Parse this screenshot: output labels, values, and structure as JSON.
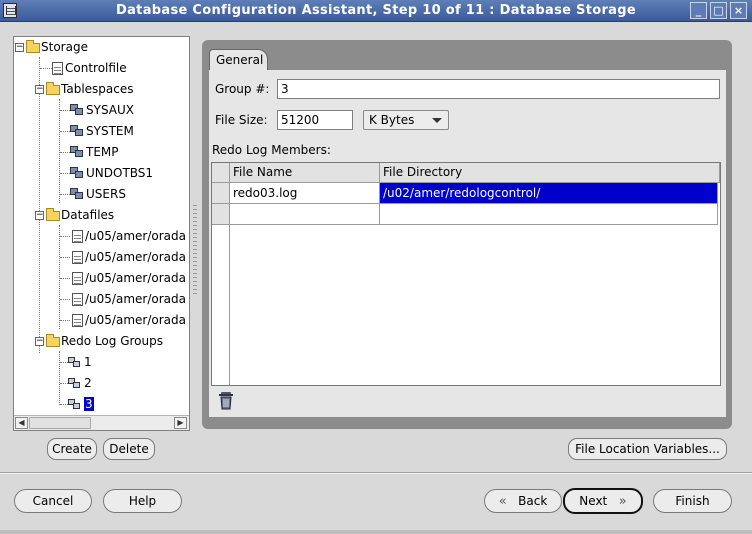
{
  "window": {
    "title": "Database Configuration Assistant, Step 10 of 11 : Database Storage",
    "buttons": [
      "_",
      "□",
      "×"
    ]
  },
  "tree": {
    "root": "Storage",
    "controlfile": "Controlfile",
    "tablespaces": {
      "label": "Tablespaces",
      "items": [
        "SYSAUX",
        "SYSTEM",
        "TEMP",
        "UNDOTBS1",
        "USERS"
      ]
    },
    "datafiles": {
      "label": "Datafiles",
      "items": [
        "/u05/amer/orada",
        "/u05/amer/orada",
        "/u05/amer/orada",
        "/u05/amer/orada",
        "/u05/amer/orada"
      ]
    },
    "redo_log_groups": {
      "label": "Redo Log Groups",
      "items": [
        "1",
        "2",
        "3"
      ],
      "selected": "3"
    }
  },
  "panel": {
    "tab_label": "General",
    "group_label": "Group #:",
    "group_value": "3",
    "filesize_label": "File Size:",
    "filesize_value": "51200",
    "unit_value": "K Bytes",
    "members_label": "Redo Log Members:",
    "table": {
      "columns": [
        "File Name",
        "File Directory"
      ],
      "rows": [
        [
          "redo03.log",
          "/u02/amer/redologcontrol/"
        ],
        [
          "",
          ""
        ]
      ]
    }
  },
  "actions": {
    "create": "Create",
    "delete": "Delete",
    "file_location_variables": "File Location Variables..."
  },
  "footer": {
    "cancel": "Cancel",
    "help": "Help",
    "back": "Back",
    "next": "Next",
    "finish": "Finish"
  }
}
